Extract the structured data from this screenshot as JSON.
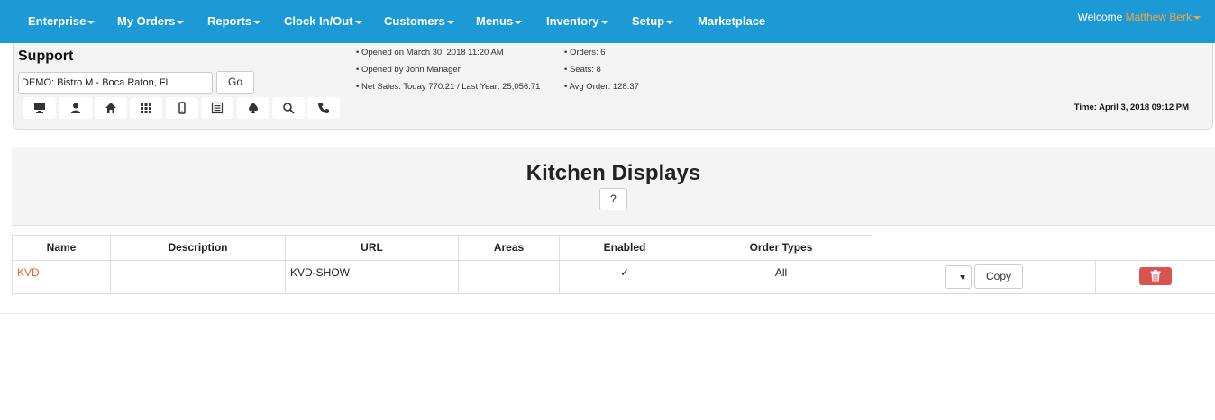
{
  "nav": {
    "items": [
      {
        "label": "Enterprise"
      },
      {
        "label": "My Orders"
      },
      {
        "label": "Reports"
      },
      {
        "label": "Clock In/Out"
      },
      {
        "label": "Customers"
      },
      {
        "label": "Menus"
      },
      {
        "label": "Inventory"
      },
      {
        "label": "Setup"
      },
      {
        "label": "Marketplace"
      }
    ],
    "welcome_text": "Welcome",
    "user_name": "Matthew Berk"
  },
  "support": {
    "title": "Support",
    "store_value": "DEMO: Bistro M - Boca Raton, FL",
    "go_label": "Go",
    "toolbar_icons": [
      "monitor-icon",
      "user-icon",
      "home-icon",
      "grid-icon",
      "mobile-icon",
      "list-icon",
      "spade-icon",
      "search-icon",
      "phone-icon"
    ],
    "info_left": [
      "• Opened on March 30, 2018 11:20 AM",
      "• Opened by John Manager",
      "• Net Sales: Today 770.21 / Last Year: 25,056.71"
    ],
    "info_right": [
      "• Orders: 6",
      "• Seats: 8",
      "• Avg Order: 128.37"
    ],
    "time": "Time: April 3, 2018 09:12 PM"
  },
  "kitchen": {
    "title": "Kitchen Displays",
    "help_label": "?",
    "columns": [
      "Name",
      "Description",
      "URL",
      "Areas",
      "Enabled",
      "Order Types"
    ],
    "rows": [
      {
        "name": "KVD",
        "description": "",
        "url": "KVD-SHOW",
        "areas": "",
        "enabled": "✓",
        "order_types": "All"
      }
    ],
    "copy_label": "Copy"
  },
  "colors": {
    "nav_bg": "#1c9ad6",
    "user_accent": "#f4a340",
    "link": "#e8632c",
    "danger": "#d9534f"
  }
}
